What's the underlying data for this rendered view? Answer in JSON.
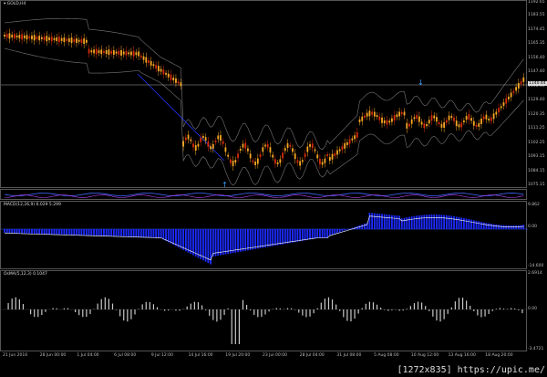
{
  "main": {
    "title": "GOLD,H4",
    "price_ticks": [
      "1192.65",
      "1183.55",
      "1174.45",
      "1165.35",
      "1156.40",
      "1147.40",
      "1138.40",
      "1129.40",
      "1120.35",
      "1111.25",
      "1102.25",
      "1093.15",
      "1084.15",
      "1075.15"
    ],
    "current_price": "1140.44",
    "colors": {
      "bull": "#f5a623",
      "bear": "#d62a0a",
      "band": "#777777",
      "ma": "#2233ff"
    }
  },
  "macd": {
    "title": "MACD(12,26,9) 6.029 5.299",
    "ticks": [
      "9.862",
      "0.00",
      "-14.600"
    ],
    "colors": {
      "hist": "#1d2bff",
      "signal": "#ffffff"
    }
  },
  "osma": {
    "title": "OsMA(5,12,3) 0.1047",
    "ticks": [
      "2.6914",
      "0.00",
      "-3.4721"
    ],
    "colors": {
      "bar": "#c8c8c8"
    }
  },
  "xaxis": {
    "labels": [
      "21 Jun 2016",
      "28 Jun 00:00",
      "1 Jul 04:00",
      "6 Jul 08:00",
      "9 Jul 12:00",
      "14 Jul 16:00",
      "19 Jul 20:00",
      "23 Jul 00:00",
      "28 Jul 04:00",
      "31 Jul 08:00",
      "5 Aug 08:00",
      "10 Aug 12:00",
      "13 Aug 16:00",
      "18 Aug 20:00"
    ]
  },
  "watermark": "[1272x835] https://upic.me/"
}
